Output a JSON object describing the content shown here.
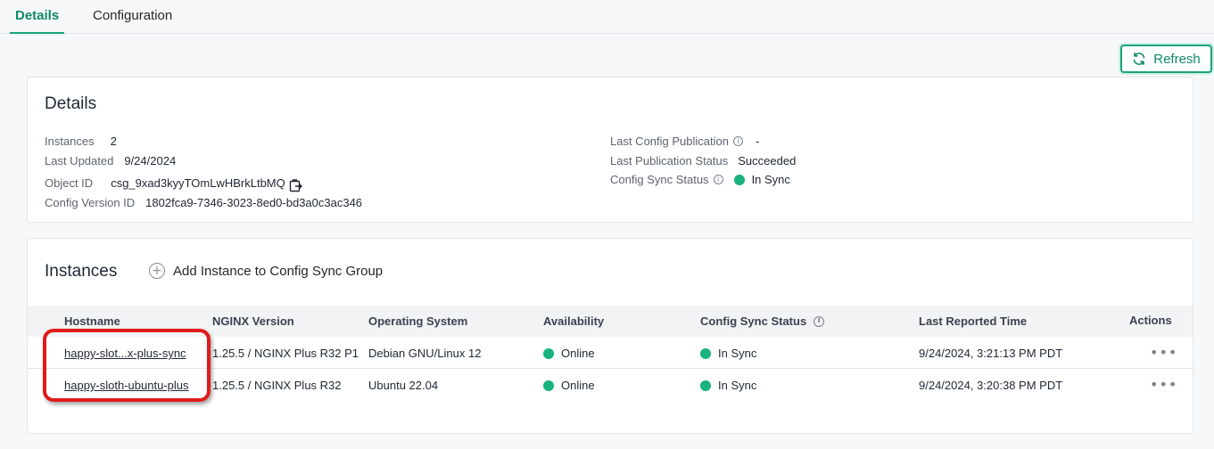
{
  "tabs": [
    {
      "label": "Details",
      "active": true
    },
    {
      "label": "Configuration",
      "active": false
    }
  ],
  "refresh_label": "Refresh",
  "details": {
    "title": "Details",
    "instances_label": "Instances",
    "instances_value": "2",
    "last_updated_label": "Last Updated",
    "last_updated_value": "9/24/2024",
    "object_id_label": "Object ID",
    "object_id_value": "csg_9xad3kyyTOmLwHBrkLtbMQ",
    "config_version_label": "Config Version ID",
    "config_version_value": "1802fca9-7346-3023-8ed0-bd3a0c3ac346",
    "last_config_pub_label": "Last Config Publication",
    "last_config_pub_value": "-",
    "last_pub_status_label": "Last Publication Status",
    "last_pub_status_value": "Succeeded",
    "config_sync_label": "Config Sync Status",
    "config_sync_value": "In Sync"
  },
  "instances": {
    "title": "Instances",
    "add_label": "Add Instance to Config Sync Group",
    "columns": {
      "hostname": "Hostname",
      "nginx": "NGINX Version",
      "os": "Operating System",
      "availability": "Availability",
      "sync": "Config Sync Status",
      "reported": "Last Reported Time",
      "actions": "Actions"
    },
    "rows": [
      {
        "hostname": "happy-slot...x-plus-sync",
        "nginx": "1.25.5 / NGINX Plus R32 P1",
        "os": "Debian GNU/Linux 12",
        "availability": "Online",
        "sync": "In Sync",
        "reported": "9/24/2024, 3:21:13 PM PDT"
      },
      {
        "hostname": "happy-sloth-ubuntu-plus",
        "nginx": "1.25.5 / NGINX Plus R32",
        "os": "Ubuntu 22.04",
        "availability": "Online",
        "sync": "In Sync",
        "reported": "9/24/2024, 3:20:38 PM PDT"
      }
    ]
  },
  "colors": {
    "accent": "#13a37b",
    "status_green": "#18b27e",
    "highlight_red": "#e01b1b"
  },
  "icons": {
    "refresh": "refresh-icon",
    "copy": "copy-icon",
    "info": "info-icon",
    "add": "plus-circle-icon",
    "actions": "more-horizontal-icon"
  }
}
